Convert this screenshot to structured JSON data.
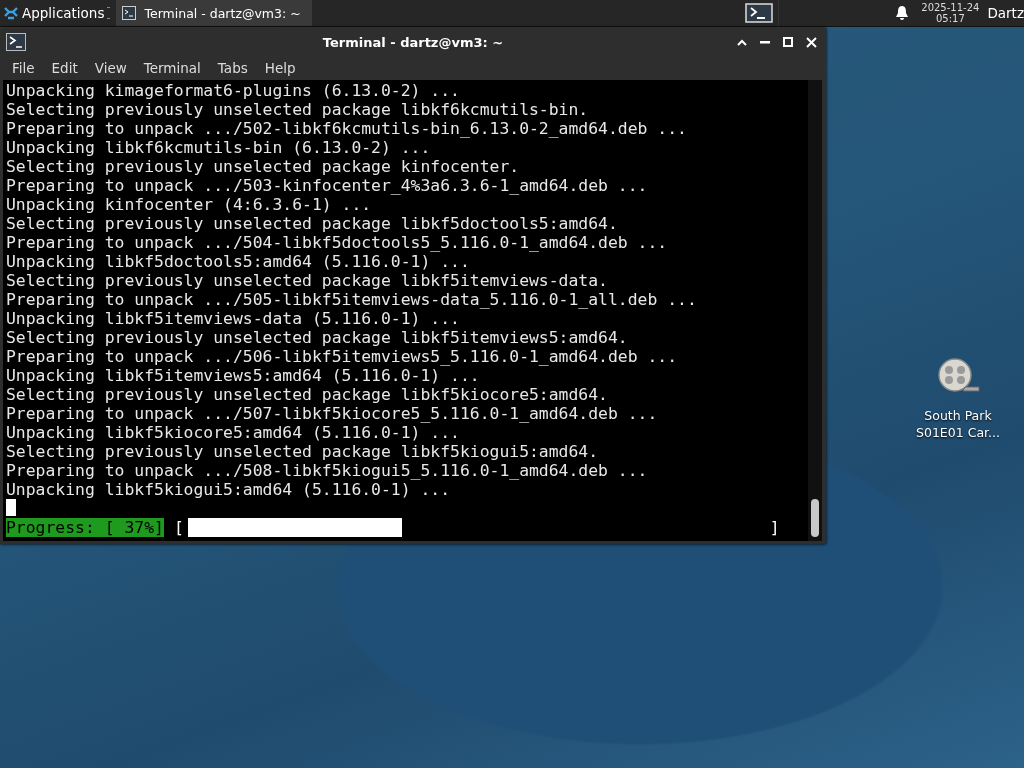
{
  "panel": {
    "applications_label": "Applications",
    "tasks": [
      {
        "title": "Terminal - dartz@vm3: ~",
        "selected": true
      }
    ],
    "clock": {
      "date": "2025-11-24",
      "time": "05:17"
    },
    "user": "Dartz"
  },
  "window": {
    "title": "Terminal - dartz@vm3: ~",
    "menu": [
      "File",
      "Edit",
      "View",
      "Terminal",
      "Tabs",
      "Help"
    ],
    "lines": [
      "Unpacking kimageformat6-plugins (6.13.0-2) ...",
      "Selecting previously unselected package libkf6kcmutils-bin.",
      "Preparing to unpack .../502-libkf6kcmutils-bin_6.13.0-2_amd64.deb ...",
      "Unpacking libkf6kcmutils-bin (6.13.0-2) ...",
      "Selecting previously unselected package kinfocenter.",
      "Preparing to unpack .../503-kinfocenter_4%3a6.3.6-1_amd64.deb ...",
      "Unpacking kinfocenter (4:6.3.6-1) ...",
      "Selecting previously unselected package libkf5doctools5:amd64.",
      "Preparing to unpack .../504-libkf5doctools5_5.116.0-1_amd64.deb ...",
      "Unpacking libkf5doctools5:amd64 (5.116.0-1) ...",
      "Selecting previously unselected package libkf5itemviews-data.",
      "Preparing to unpack .../505-libkf5itemviews-data_5.116.0-1_all.deb ...",
      "Unpacking libkf5itemviews-data (5.116.0-1) ...",
      "Selecting previously unselected package libkf5itemviews5:amd64.",
      "Preparing to unpack .../506-libkf5itemviews5_5.116.0-1_amd64.deb ...",
      "Unpacking libkf5itemviews5:amd64 (5.116.0-1) ...",
      "Selecting previously unselected package libkf5kiocore5:amd64.",
      "Preparing to unpack .../507-libkf5kiocore5_5.116.0-1_amd64.deb ...",
      "Unpacking libkf5kiocore5:amd64 (5.116.0-1) ...",
      "Selecting previously unselected package libkf5kiogui5:amd64.",
      "Preparing to unpack .../508-libkf5kiogui5_5.116.0-1_amd64.deb ...",
      "Unpacking libkf5kiogui5:amd64 (5.116.0-1) ..."
    ],
    "progress": {
      "label": "Progress: [ 37%]",
      "open": "[",
      "close": "]",
      "level": 0.37
    }
  },
  "desktop_icons": [
    {
      "label": "South Park S01E01 Car..."
    }
  ]
}
